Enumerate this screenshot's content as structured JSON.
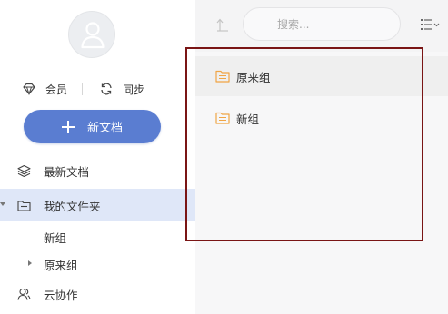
{
  "sidebar": {
    "quick": {
      "member_label": "会员",
      "sync_label": "同步"
    },
    "new_doc_label": "新文档",
    "nav": {
      "recent_label": "最新文档",
      "my_folder_label": "我的文件夹",
      "sub_items": [
        "新组",
        "原来组"
      ],
      "cloud_label": "云协作"
    }
  },
  "toolbar": {
    "search_placeholder": "搜索..."
  },
  "folders": [
    "原来组",
    "新组"
  ],
  "colors": {
    "accent": "#5a7dd1",
    "active_bg": "#dfe7f8",
    "folder": "#f0a545",
    "highlight": "#7a1515"
  }
}
